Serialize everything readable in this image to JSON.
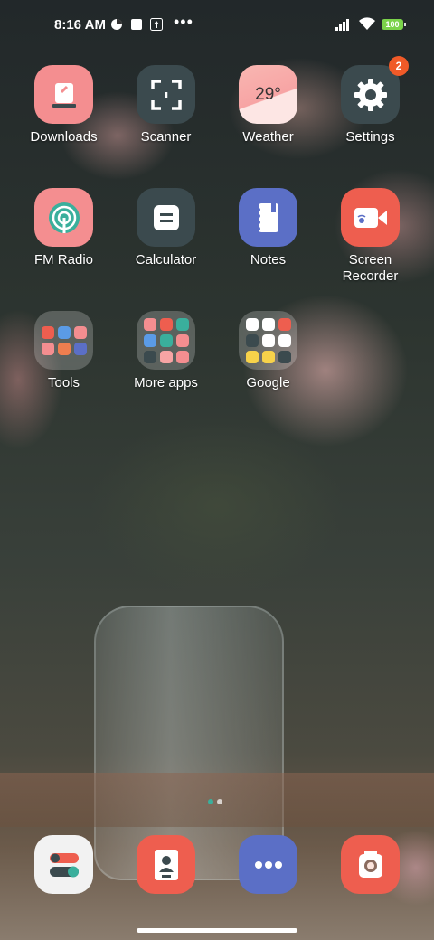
{
  "status_bar": {
    "time": "8:16 AM",
    "battery": "100",
    "icons": [
      "data-saver-icon",
      "notification-square-icon",
      "upload-icon",
      "more-dots-icon",
      "signal-icon",
      "wifi-icon",
      "battery-icon"
    ]
  },
  "apps": [
    {
      "label": "Downloads",
      "icon": "downloads-icon",
      "bg": "#f48e90"
    },
    {
      "label": "Scanner",
      "icon": "scanner-icon",
      "bg": "#3b4a4e"
    },
    {
      "label": "Weather",
      "icon": "weather-icon",
      "bg": "#f7a4a4",
      "temp": "29°"
    },
    {
      "label": "Settings",
      "icon": "gear-icon",
      "bg": "#3b4a4e",
      "badge": "2"
    },
    {
      "label": "FM Radio",
      "icon": "radio-icon",
      "bg": "#f48e90"
    },
    {
      "label": "Calculator",
      "icon": "calculator-icon",
      "bg": "#3b4a4e"
    },
    {
      "label": "Notes",
      "icon": "notes-icon",
      "bg": "#5b6fc6"
    },
    {
      "label": "Screen\nRecorder",
      "icon": "screen-recorder-icon",
      "bg": "#ee5e4f"
    },
    {
      "label": "Tools",
      "icon": "folder-icon"
    },
    {
      "label": "More apps",
      "icon": "folder-icon"
    },
    {
      "label": "Google",
      "icon": "folder-icon"
    }
  ],
  "dock": [
    {
      "icon": "phone-dialer-icon",
      "bg": "#f2f2f2"
    },
    {
      "icon": "contacts-icon",
      "bg": "#ee5e4f"
    },
    {
      "icon": "messages-icon",
      "bg": "#5b6fc6"
    },
    {
      "icon": "camera-icon",
      "bg": "#ee5e4f"
    }
  ]
}
